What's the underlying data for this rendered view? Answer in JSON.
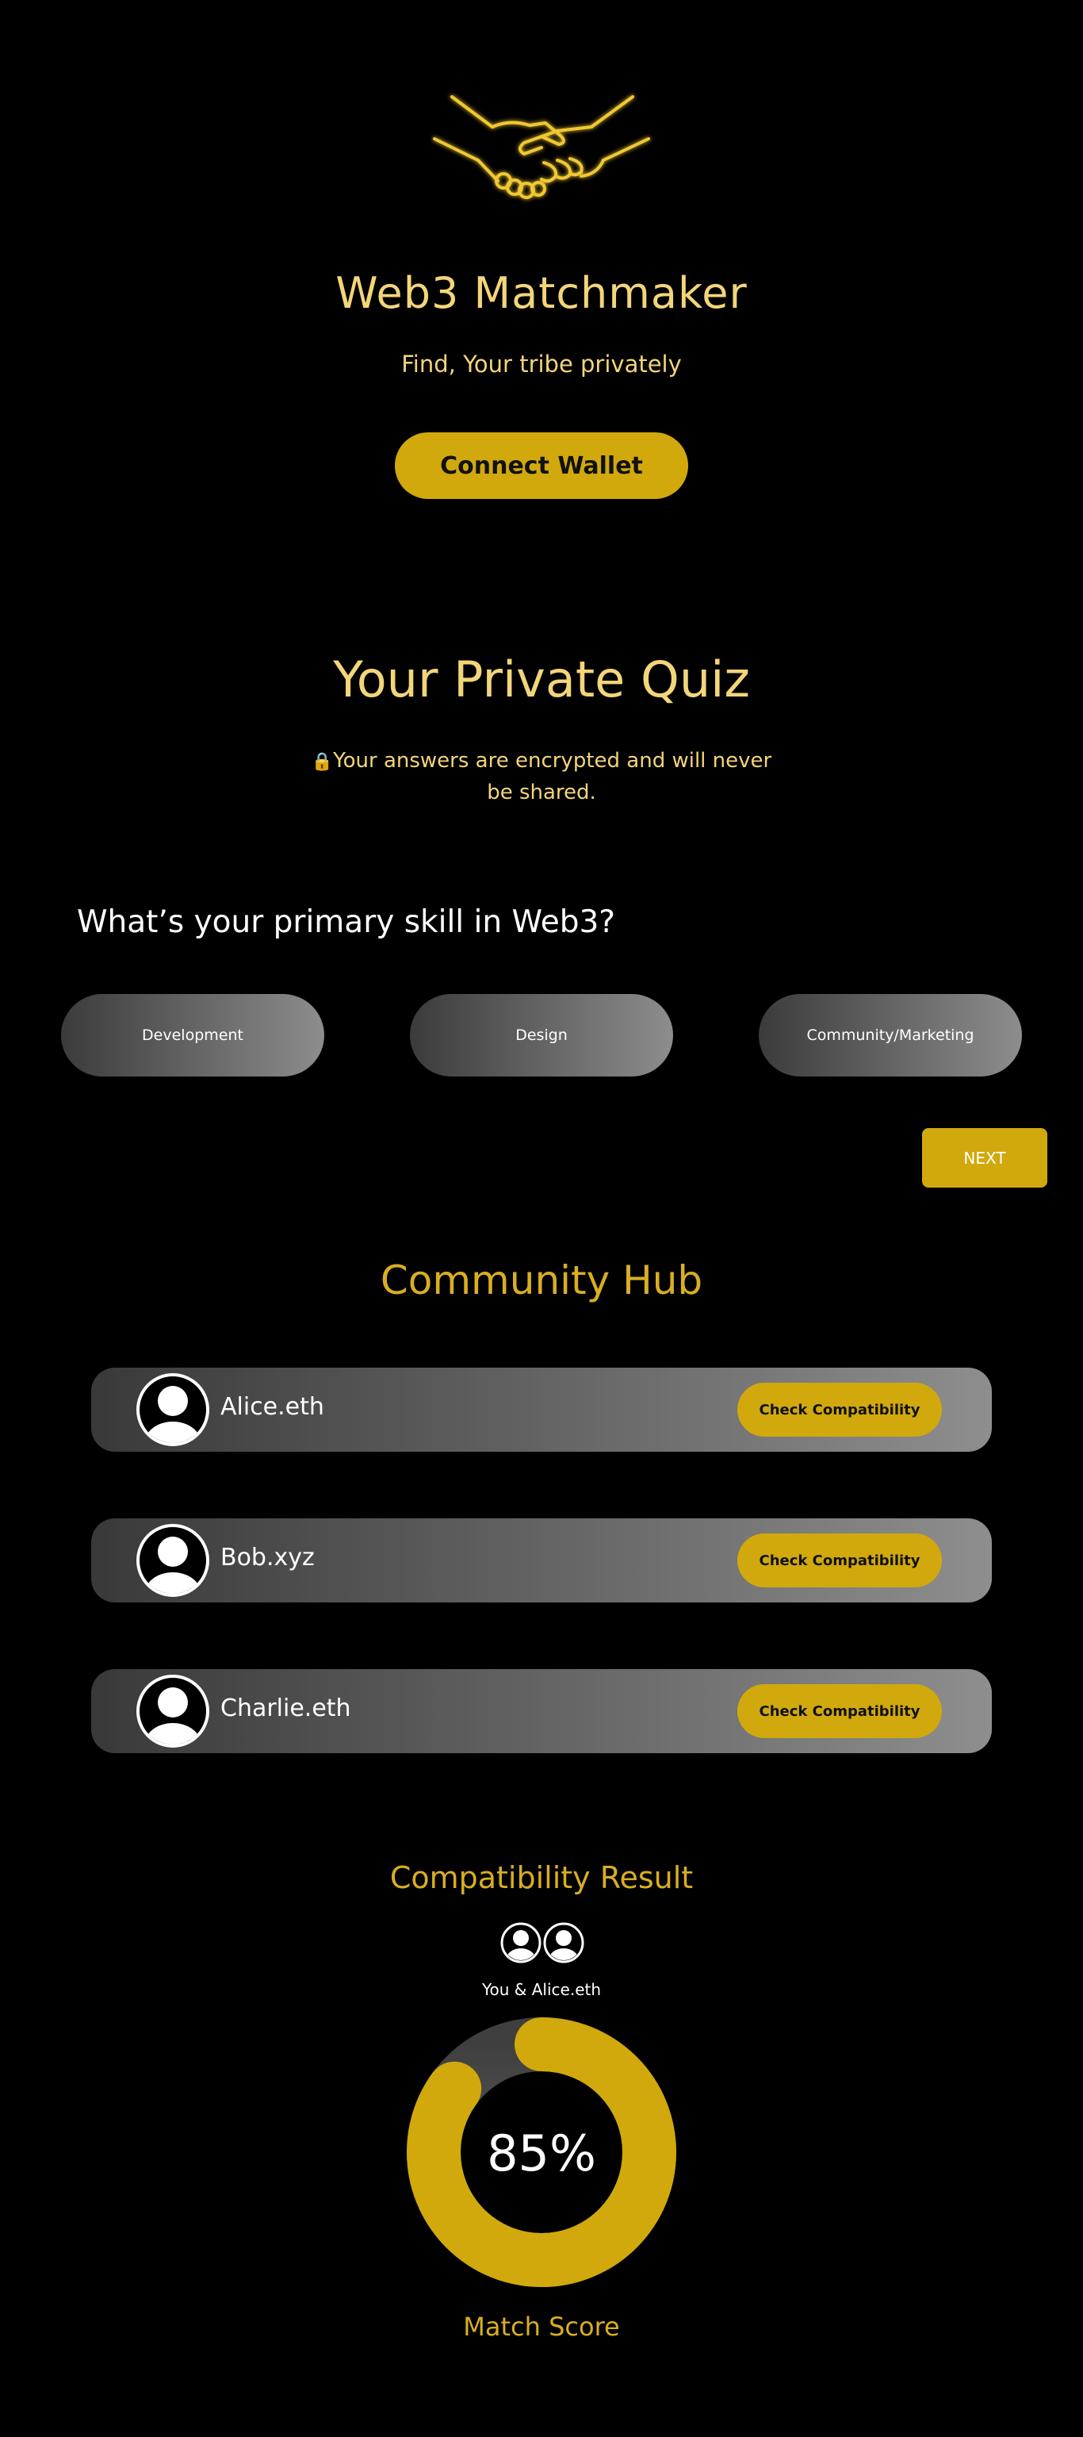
{
  "hero": {
    "logo_icon": "handshake-icon",
    "title": "Web3 Matchmaker",
    "tagline": "Find, Your tribe privately",
    "connect_label": "Connect Wallet"
  },
  "quiz": {
    "title": "Your Private Quiz",
    "lock_icon": "🔒",
    "note": "Your answers are encrypted and will never be shared.",
    "question": "What’s your primary skill in Web3?",
    "options": [
      "Development",
      "Design",
      "Community/Marketing"
    ],
    "next_label": "NEXT"
  },
  "community": {
    "title": "Community Hub",
    "members": [
      {
        "name": "Alice.eth",
        "button": "Check Compatibility"
      },
      {
        "name": "Bob.xyz",
        "button": "Check Compatibility"
      },
      {
        "name": "Charlie.eth",
        "button": "Check Compatibility"
      }
    ]
  },
  "result": {
    "title": "Compatibility Result",
    "pair_label": "You & Alice.eth",
    "score_text": "85%",
    "score_fraction": 0.85,
    "score_label": "Match Score"
  },
  "colors": {
    "accent": "#d1a90d",
    "title_text": "#f3d57a",
    "heading_gold": "#d9ae22",
    "background": "#000000"
  }
}
